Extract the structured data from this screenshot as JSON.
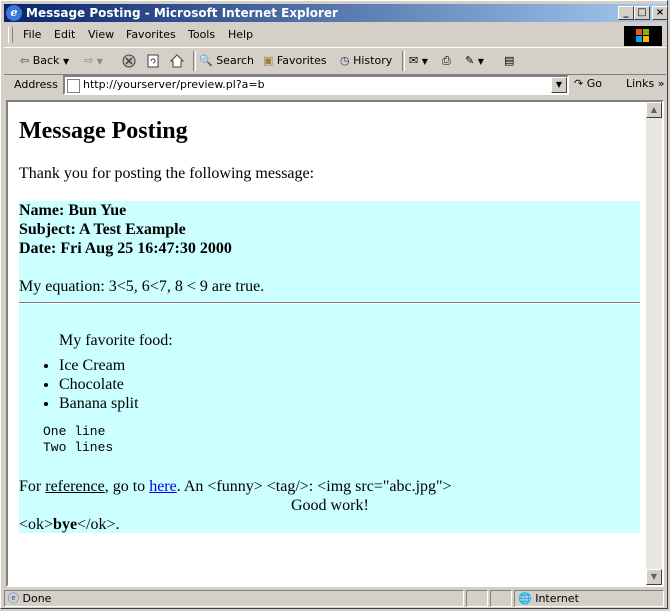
{
  "window": {
    "title": "Message Posting - Microsoft Internet Explorer",
    "minimize_glyph": "_",
    "maximize_glyph": "□",
    "close_glyph": "×"
  },
  "menubar": {
    "items": [
      "File",
      "Edit",
      "View",
      "Favorites",
      "Tools",
      "Help"
    ]
  },
  "toolbar": {
    "back_label": "Back",
    "search_label": "Search",
    "favorites_label": "Favorites",
    "history_label": "History"
  },
  "address": {
    "label": "Address",
    "url": "http://yourserver/preview.pl?a=b",
    "go_label": "Go",
    "links_label": "Links"
  },
  "page": {
    "heading": "Message Posting",
    "intro": "Thank you for posting the following message:",
    "name_line": "Name: Bun Yue",
    "subject_line": "Subject: A Test Example",
    "date_line": "Date: Fri Aug 25 16:47:30 2000",
    "equation": "My equation: 3<5, 6<7, 8 < 9 are true.",
    "food_title": "My favorite food:",
    "food_items": [
      "Ice Cream",
      "Chocolate",
      "Banana split"
    ],
    "pre_line1": "One line",
    "pre_line2": "Two lines",
    "para_for": "For ",
    "para_reference": "reference",
    "para_goto": ", go to ",
    "para_link": "here",
    "para_rest": ". An <funny> <tag/>: <img src=\"abc.jpg\">",
    "good_work": "Good work!",
    "ok_open": "<ok>",
    "ok_bold": "bye",
    "ok_close": "</ok>."
  },
  "status": {
    "text": "Done",
    "zone": "Internet"
  },
  "colors": {
    "message_bg": "#ccffff",
    "title_gradient_start": "#0a246a",
    "title_gradient_end": "#a6caf0",
    "link": "#0000ee"
  }
}
